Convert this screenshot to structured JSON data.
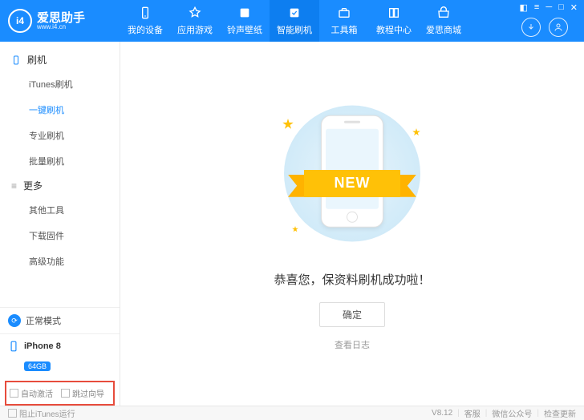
{
  "brand": {
    "name": "爱思助手",
    "url": "www.i4.cn",
    "logo_text": "i4"
  },
  "nav": [
    {
      "label": "我的设备"
    },
    {
      "label": "应用游戏"
    },
    {
      "label": "铃声壁纸"
    },
    {
      "label": "智能刷机"
    },
    {
      "label": "工具箱"
    },
    {
      "label": "教程中心"
    },
    {
      "label": "爱思商城"
    }
  ],
  "sidebar": {
    "section1": {
      "title": "刷机",
      "items": [
        "iTunes刷机",
        "一键刷机",
        "专业刷机",
        "批量刷机"
      ]
    },
    "section2": {
      "title": "更多",
      "items": [
        "其他工具",
        "下载固件",
        "高级功能"
      ]
    }
  },
  "status": {
    "mode": "正常模式"
  },
  "device": {
    "name": "iPhone 8",
    "storage": "64GB"
  },
  "bottom_opts": {
    "opt1": "自动激活",
    "opt2": "跳过向导"
  },
  "main": {
    "ribbon": "NEW",
    "success": "恭喜您，保资料刷机成功啦！",
    "ok": "确定",
    "log": "查看日志"
  },
  "footer": {
    "block_itunes": "阻止iTunes运行",
    "version": "V8.12",
    "support": "客服",
    "wechat": "微信公众号",
    "update": "检查更新"
  }
}
